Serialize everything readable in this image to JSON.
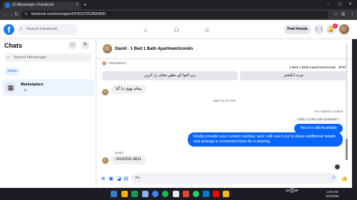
{
  "browser": {
    "tab_title": "(2) Messenger | Facebook",
    "new_tab": "+",
    "minimize": "–",
    "maximize": "▢",
    "close": "✕",
    "tab_close": "×",
    "url": "facebook.com/messages/t/9781075518590830"
  },
  "facebook": {
    "logo": "f",
    "search_placeholder": "Search Facebook",
    "find_friends": "Find friends",
    "notification_count": "2"
  },
  "sidebar": {
    "title": "Chats",
    "search_placeholder": "Search Messenger",
    "filter": "Inbox",
    "conversations": [
      {
        "name": "Marketplace",
        "time": "3h"
      }
    ]
  },
  "chat": {
    "title": "David · 1 Bed 1 Bath Apartment/condo",
    "marketplace_label": "Marketplace",
    "listing": "1 Bed 1 Bath Apartment/condo · $700",
    "quick_replies": [
      "زیر التوا کے بطور نشان زد کریں",
      "مزید ایکشنز"
    ],
    "messages_in": [
      {
        "text": "پیغام بھیج دیا گیا"
      }
    ],
    "time_separator": "Wed 11:20 PM",
    "reply_note": "You replied to David",
    "quoted": "Hello, is this still available?",
    "messages_out": [
      {
        "text": "Yes it is still Available"
      },
      {
        "text": "Kindly provide your contact number, and I will reach out to share additional details and arrange a convenient time for a viewing."
      }
    ],
    "sender_name": "David",
    "last_message": "(414)315-3811",
    "composer_placeholder": "Aa"
  },
  "taskbar": {
    "time": "3:00 AM",
    "date": "3/27/2025"
  },
  "colors": {
    "facebook_blue": "#1877f2",
    "outgoing_bubble": "#0866ff",
    "incoming_bubble": "#f0f0f0"
  }
}
